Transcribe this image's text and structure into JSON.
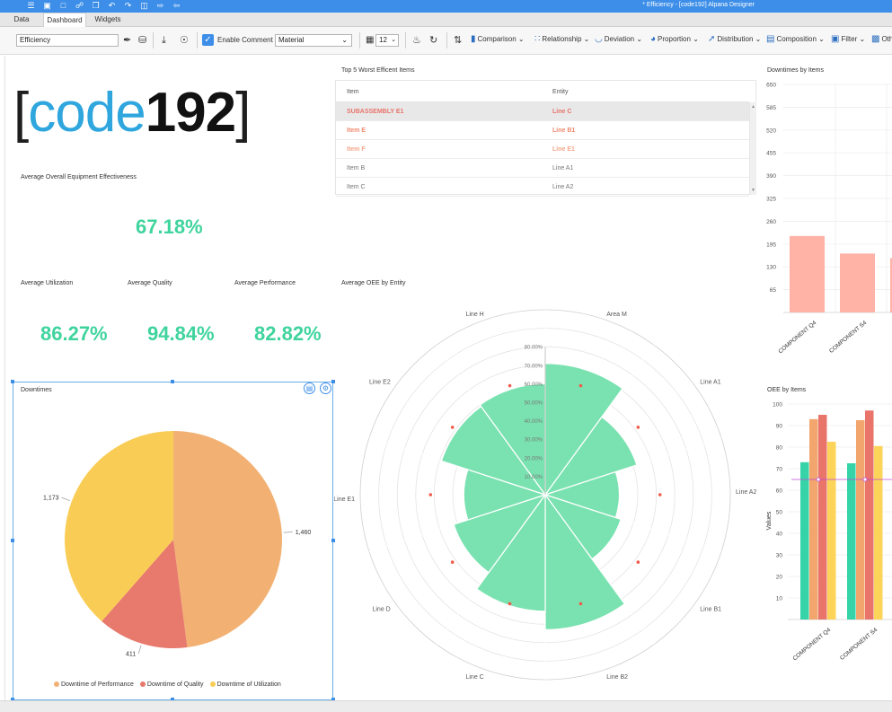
{
  "window": {
    "title": "* Efficiency - [code192] Alpana Designer"
  },
  "tabs": [
    "Data",
    "Dashboard",
    "Widgets"
  ],
  "toolbar": {
    "dashboard_name": "Efficiency",
    "enable_comment_label": "Enable Comment",
    "theme_value": "Material",
    "grid_value": "12",
    "menus": [
      "Comparison",
      "Relationship",
      "Deviation",
      "Proportion",
      "Distribution",
      "Composition",
      "Filter",
      "Oth"
    ]
  },
  "logo": {
    "bracket_left": "[",
    "code": "code",
    "num": "192",
    "bracket_right": "]"
  },
  "kpis": {
    "oee": {
      "label": "Average Overall Equipment Effectiveness",
      "value": "67.18%"
    },
    "utilization": {
      "label": "Average Utilization",
      "value": "86.27%"
    },
    "quality": {
      "label": "Average Quality",
      "value": "94.84%"
    },
    "performance": {
      "label": "Average Performance",
      "value": "82.82%"
    }
  },
  "worst_items": {
    "title": "Top 5 Worst Efficent Items",
    "columns": [
      "Item",
      "Entity"
    ],
    "rows": [
      {
        "item": "SUBASSEMBLY E1",
        "entity": "Line C",
        "color": "#e8746a"
      },
      {
        "item": "Item E",
        "entity": "Line B1",
        "color": "#f08a6e"
      },
      {
        "item": "Item F",
        "entity": "Line E1",
        "color": "#f4a58a"
      },
      {
        "item": "Item B",
        "entity": "Line A1",
        "color": "#777777"
      },
      {
        "item": "Item C",
        "entity": "Line A2",
        "color": "#777777"
      }
    ]
  },
  "colors": {
    "accent": "#3d8ee8",
    "kpi": "#3fd49d",
    "polar_fill": "#7ae2b0"
  },
  "chart_data": [
    {
      "type": "pie",
      "title": "Downtimes",
      "slices": [
        {
          "name": "Downtime of Performance",
          "value": 1460,
          "label": "1,460",
          "color": "#f2b173"
        },
        {
          "name": "Downtime of Quality",
          "value": 411,
          "label": "411",
          "color": "#e8796d"
        },
        {
          "name": "Downtime of Utilization",
          "value": 1173,
          "label": "1,173",
          "color": "#f9cd55"
        }
      ]
    },
    {
      "type": "polar-bar",
      "title": "Average OEE by Entity",
      "categories": [
        "Area M",
        "Line A1",
        "Line A2",
        "Line B1",
        "Line B2",
        "Line C",
        "Line D",
        "Line E1",
        "Line E2",
        "Line H"
      ],
      "values": [
        71,
        52,
        40,
        43,
        73,
        63,
        52,
        44,
        59,
        60
      ],
      "markers": [
        62,
        62,
        62,
        62,
        62,
        62,
        62,
        62,
        62,
        62
      ],
      "r_ticks": [
        "10.00%",
        "20.00%",
        "30.00%",
        "40.00%",
        "50.00%",
        "60.00%",
        "70.00%",
        "80.00%"
      ],
      "r_max": 80
    },
    {
      "type": "bar",
      "title": "Downtimes by Items",
      "categories": [
        "COMPONENT Q4",
        "COMPONENT S4"
      ],
      "values": [
        218,
        168
      ],
      "y_ticks": [
        65,
        130,
        195,
        260,
        325,
        390,
        455,
        520,
        585,
        650
      ],
      "ylim": [
        0,
        650
      ],
      "color": "#ffb3a7"
    },
    {
      "type": "bar",
      "title": "OEE by Items",
      "ylabel": "Values",
      "categories": [
        "COMPONENT Q4",
        "COMPONENT S4"
      ],
      "series": [
        {
          "values": [
            73,
            72.5
          ],
          "color": "#35d3a7"
        },
        {
          "values": [
            93,
            92.5
          ],
          "color": "#f2a56c"
        },
        {
          "values": [
            95,
            97
          ],
          "color": "#e8746a"
        },
        {
          "values": [
            82.5,
            80.5
          ],
          "color": "#fcd45a"
        }
      ],
      "line": {
        "values": [
          65,
          65
        ],
        "color": "#c04bd6"
      },
      "y_ticks": [
        10,
        20,
        30,
        40,
        50,
        60,
        70,
        80,
        90,
        100
      ],
      "ylim": [
        0,
        100
      ]
    }
  ]
}
